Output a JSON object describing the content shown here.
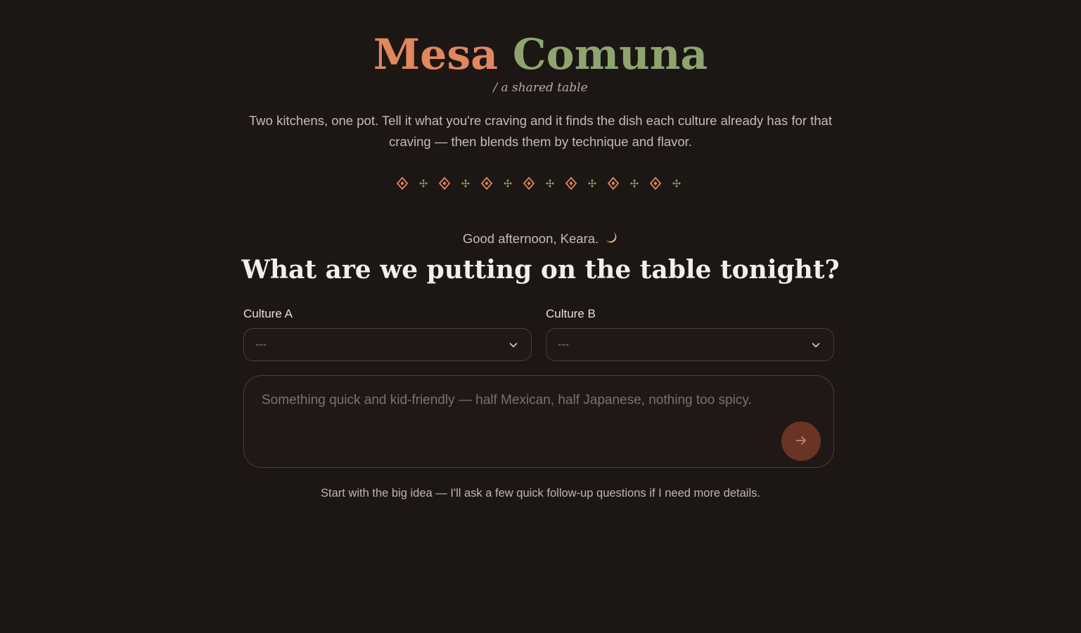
{
  "brand": {
    "word1": "Mesa",
    "word2": "Comuna",
    "tagline": "/ a shared table",
    "colors": {
      "primary": "#e0875f",
      "secondary": "#8ea56f"
    }
  },
  "intro": "Two kitchens, one pot. Tell it what you're craving and it finds the dish each culture already has for that craving — then blends them by technique and flavor.",
  "greeting": {
    "text": "Good afternoon, Keara.",
    "icon": "moon-icon"
  },
  "headline": "What are we putting on the table tonight?",
  "culture_a": {
    "label": "Culture A",
    "selected": "---",
    "icon": "chevron-down-icon"
  },
  "culture_b": {
    "label": "Culture B",
    "selected": "---",
    "icon": "chevron-down-icon"
  },
  "prompt": {
    "placeholder": "Something quick and kid-friendly — half Mexican, half Japanese, nothing too spicy.",
    "value": "",
    "send_icon": "arrow-right-icon"
  },
  "hint": "Start with the big idea — I'll ask a few quick follow-up questions if I need more details.",
  "colors": {
    "background": "#1c1614",
    "border": "#5a3a30",
    "send_button": "#6a3424"
  }
}
